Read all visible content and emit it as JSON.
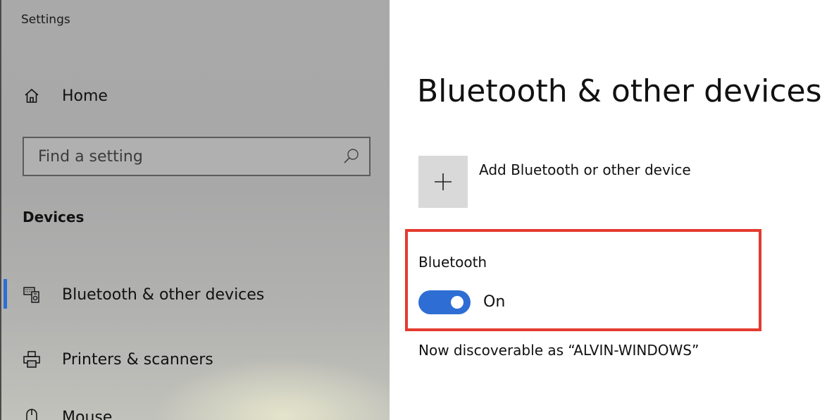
{
  "app": {
    "title": "Settings"
  },
  "sidebar": {
    "home_label": "Home",
    "search": {
      "placeholder": "Find a setting",
      "value": ""
    },
    "section_heading": "Devices",
    "items": [
      {
        "label": "Bluetooth & other devices",
        "icon": "bluetooth-devices-icon",
        "active": true
      },
      {
        "label": "Printers & scanners",
        "icon": "printer-icon",
        "active": false
      },
      {
        "label": "Mouse",
        "icon": "mouse-icon",
        "active": false
      }
    ]
  },
  "main": {
    "title": "Bluetooth & other devices",
    "add_device_label": "Add Bluetooth or other device",
    "bluetooth": {
      "label": "Bluetooth",
      "toggle_state": "On",
      "enabled": true
    },
    "discoverable_text": "Now discoverable as “ALVIN-WINDOWS”"
  },
  "colors": {
    "accent": "#2e6ed4",
    "highlight": "#e53a2f",
    "sidebar_bg": "#a9a9a9",
    "tile_bg": "#d9d9d9"
  }
}
